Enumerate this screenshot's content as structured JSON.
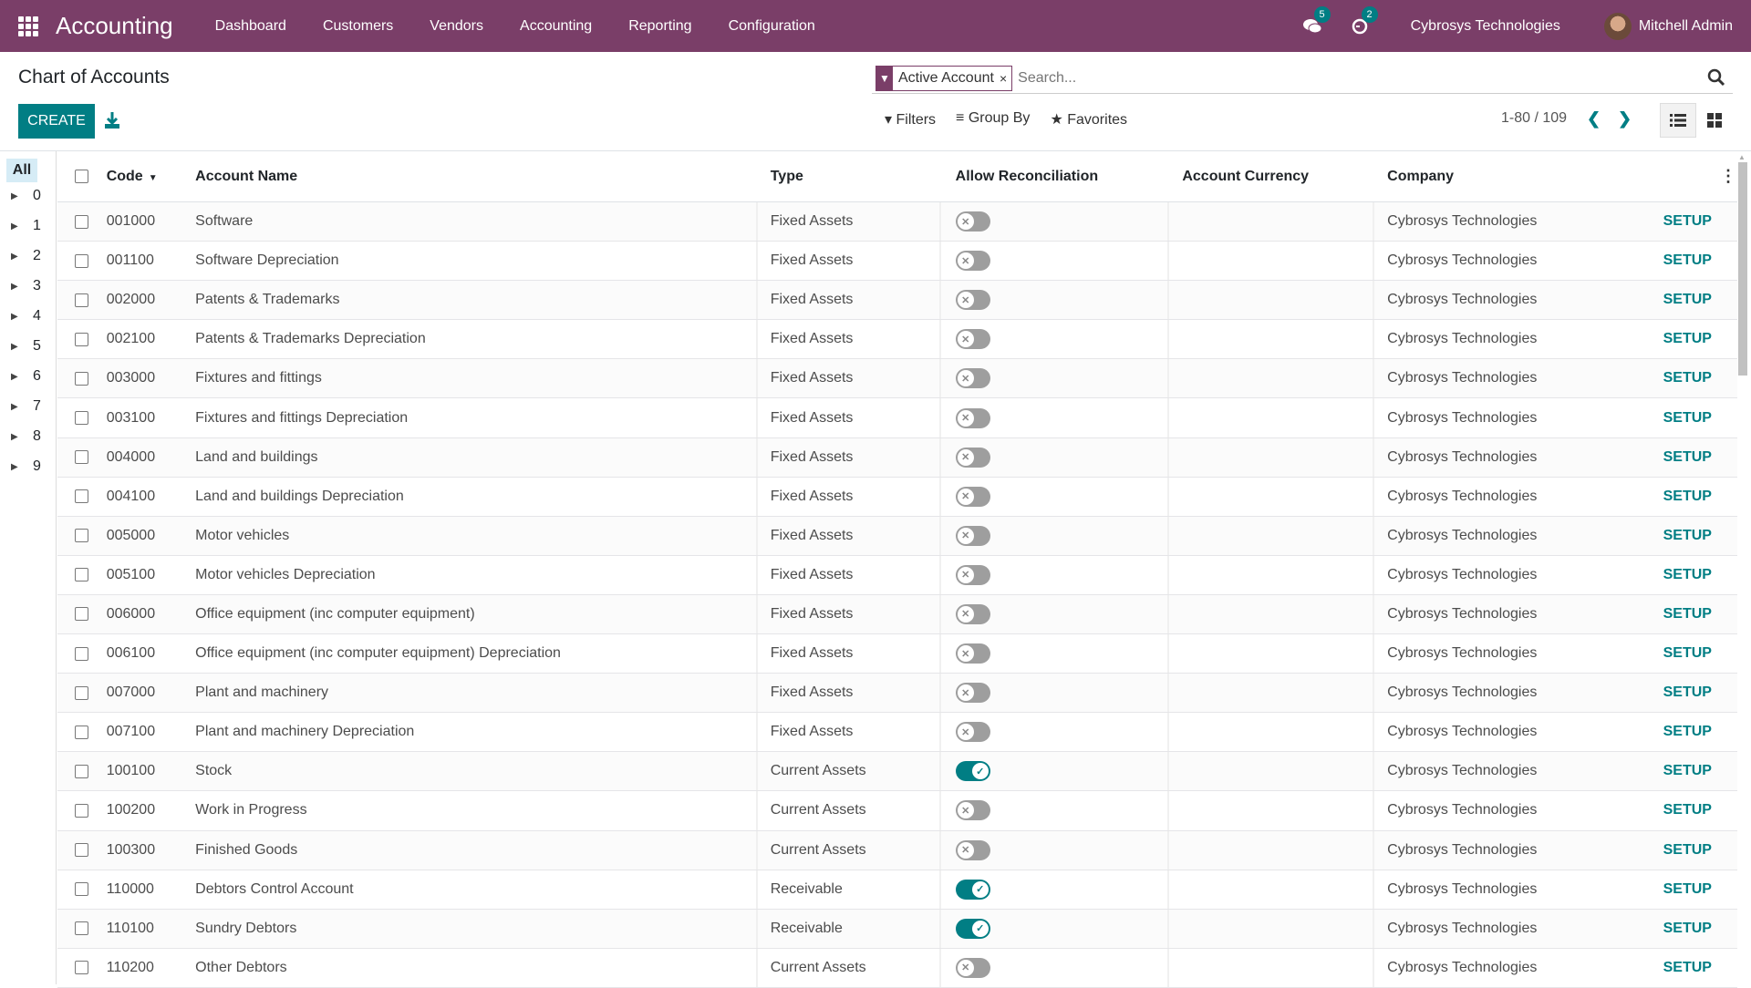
{
  "navbar": {
    "app_name": "Accounting",
    "menu": [
      "Dashboard",
      "Customers",
      "Vendors",
      "Accounting",
      "Reporting",
      "Configuration"
    ],
    "messages_badge": "5",
    "activities_badge": "2",
    "company": "Cybrosys Technologies",
    "user": "Mitchell Admin",
    "brand_color": "#7a3e68"
  },
  "page": {
    "title": "Chart of Accounts",
    "create_label": "CREATE"
  },
  "search": {
    "facet_label": "Active Account",
    "facet_remove": "×",
    "placeholder": "Search..."
  },
  "filters": {
    "filters_label": "Filters",
    "groupby_label": "Group By",
    "favorites_label": "Favorites"
  },
  "pager": {
    "value": "1-80 / 109"
  },
  "sidepanel": {
    "all_label": "All",
    "items": [
      "0",
      "1",
      "2",
      "3",
      "4",
      "5",
      "6",
      "7",
      "8",
      "9"
    ]
  },
  "table": {
    "headers": {
      "code": "Code",
      "name": "Account Name",
      "type": "Type",
      "reconcile": "Allow Reconciliation",
      "currency": "Account Currency",
      "company": "Company"
    },
    "setup_label": "SETUP",
    "accent_color": "#017e84",
    "rows": [
      {
        "code": "001000",
        "name": "Software",
        "type": "Fixed Assets",
        "reconcile": false,
        "currency": "",
        "company": "Cybrosys Technologies"
      },
      {
        "code": "001100",
        "name": "Software Depreciation",
        "type": "Fixed Assets",
        "reconcile": false,
        "currency": "",
        "company": "Cybrosys Technologies"
      },
      {
        "code": "002000",
        "name": "Patents & Trademarks",
        "type": "Fixed Assets",
        "reconcile": false,
        "currency": "",
        "company": "Cybrosys Technologies"
      },
      {
        "code": "002100",
        "name": "Patents & Trademarks Depreciation",
        "type": "Fixed Assets",
        "reconcile": false,
        "currency": "",
        "company": "Cybrosys Technologies"
      },
      {
        "code": "003000",
        "name": "Fixtures and fittings",
        "type": "Fixed Assets",
        "reconcile": false,
        "currency": "",
        "company": "Cybrosys Technologies"
      },
      {
        "code": "003100",
        "name": "Fixtures and fittings Depreciation",
        "type": "Fixed Assets",
        "reconcile": false,
        "currency": "",
        "company": "Cybrosys Technologies"
      },
      {
        "code": "004000",
        "name": "Land and buildings",
        "type": "Fixed Assets",
        "reconcile": false,
        "currency": "",
        "company": "Cybrosys Technologies"
      },
      {
        "code": "004100",
        "name": "Land and buildings Depreciation",
        "type": "Fixed Assets",
        "reconcile": false,
        "currency": "",
        "company": "Cybrosys Technologies"
      },
      {
        "code": "005000",
        "name": "Motor vehicles",
        "type": "Fixed Assets",
        "reconcile": false,
        "currency": "",
        "company": "Cybrosys Technologies"
      },
      {
        "code": "005100",
        "name": "Motor vehicles Depreciation",
        "type": "Fixed Assets",
        "reconcile": false,
        "currency": "",
        "company": "Cybrosys Technologies"
      },
      {
        "code": "006000",
        "name": "Office equipment (inc computer equipment)",
        "type": "Fixed Assets",
        "reconcile": false,
        "currency": "",
        "company": "Cybrosys Technologies"
      },
      {
        "code": "006100",
        "name": "Office equipment (inc computer equipment) Depreciation",
        "type": "Fixed Assets",
        "reconcile": false,
        "currency": "",
        "company": "Cybrosys Technologies"
      },
      {
        "code": "007000",
        "name": "Plant and machinery",
        "type": "Fixed Assets",
        "reconcile": false,
        "currency": "",
        "company": "Cybrosys Technologies"
      },
      {
        "code": "007100",
        "name": "Plant and machinery Depreciation",
        "type": "Fixed Assets",
        "reconcile": false,
        "currency": "",
        "company": "Cybrosys Technologies"
      },
      {
        "code": "100100",
        "name": "Stock",
        "type": "Current Assets",
        "reconcile": true,
        "currency": "",
        "company": "Cybrosys Technologies"
      },
      {
        "code": "100200",
        "name": "Work in Progress",
        "type": "Current Assets",
        "reconcile": false,
        "currency": "",
        "company": "Cybrosys Technologies"
      },
      {
        "code": "100300",
        "name": "Finished Goods",
        "type": "Current Assets",
        "reconcile": false,
        "currency": "",
        "company": "Cybrosys Technologies"
      },
      {
        "code": "110000",
        "name": "Debtors Control Account",
        "type": "Receivable",
        "reconcile": true,
        "currency": "",
        "company": "Cybrosys Technologies"
      },
      {
        "code": "110100",
        "name": "Sundry Debtors",
        "type": "Receivable",
        "reconcile": true,
        "currency": "",
        "company": "Cybrosys Technologies"
      },
      {
        "code": "110200",
        "name": "Other Debtors",
        "type": "Current Assets",
        "reconcile": false,
        "currency": "",
        "company": "Cybrosys Technologies"
      }
    ]
  }
}
